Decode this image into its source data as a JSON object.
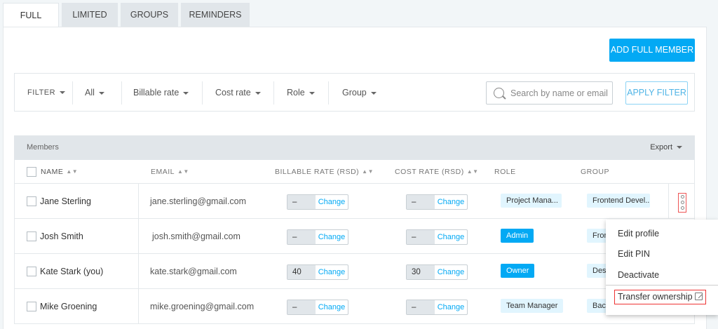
{
  "tabs": [
    {
      "label": "FULL",
      "active": true
    },
    {
      "label": "LIMITED",
      "active": false
    },
    {
      "label": "GROUPS",
      "active": false
    },
    {
      "label": "REMINDERS",
      "active": false
    }
  ],
  "add_button": "ADD FULL MEMBER",
  "filter": {
    "filter_label": "FILTER",
    "status": "All",
    "billable": "Billable rate",
    "cost": "Cost rate",
    "role": "Role",
    "group": "Group",
    "search_placeholder": "Search by name or email",
    "apply": "APPLY FILTER"
  },
  "table": {
    "title": "Members",
    "export": "Export",
    "columns": {
      "name": "NAME",
      "email": "EMAIL",
      "billable": "BILLABLE RATE (RSD)",
      "cost": "COST RATE (RSD)",
      "role": "ROLE",
      "group": "GROUP"
    },
    "change_label": "Change",
    "rows": [
      {
        "name": "Jane Sterling",
        "email": "jane.sterling@gmail.com",
        "billable": "–",
        "cost": "–",
        "role": "Project Mana...",
        "group": "Frontend Devel..."
      },
      {
        "name": "Josh Smith",
        "email": "josh.smith@gmail.com",
        "billable": "–",
        "cost": "–",
        "role": "Admin",
        "group": "Fron"
      },
      {
        "name": "Kate Stark (you)",
        "email": "kate.stark@gmail.com",
        "billable": "40",
        "cost": "30",
        "role": "Owner",
        "group": "Desi"
      },
      {
        "name": "Mike Groening",
        "email": "mike.groening@gmail.com",
        "billable": "–",
        "cost": "–",
        "role": "Team Manager",
        "group": "Back"
      }
    ]
  },
  "menu": {
    "edit_profile": "Edit profile",
    "edit_pin": "Edit PIN",
    "deactivate": "Deactivate",
    "transfer": "Transfer ownership"
  },
  "colors": {
    "accent": "#03a9f4",
    "highlight": "#e33333"
  }
}
